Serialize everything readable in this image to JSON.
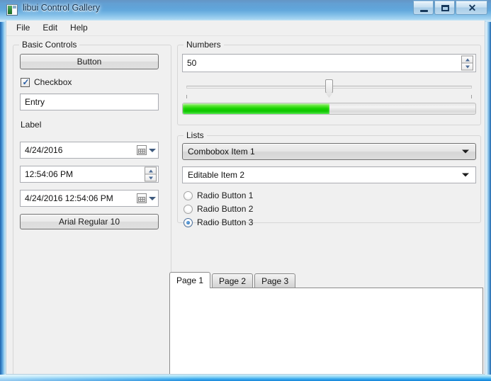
{
  "window": {
    "title": "libui Control Gallery",
    "icon": "app-icon",
    "minimize_label": "–",
    "maximize_label": "❐",
    "close_label": "✕"
  },
  "menu": {
    "items": [
      {
        "label": "File"
      },
      {
        "label": "Edit"
      },
      {
        "label": "Help"
      }
    ]
  },
  "basic_controls": {
    "title": "Basic Controls",
    "button_label": "Button",
    "checkbox_label": "Checkbox",
    "checkbox_checked": true,
    "entry_value": "Entry",
    "entry_placeholder": "",
    "label_text": "Label",
    "date_value": "4/24/2016",
    "time_value": "12:54:06 PM",
    "datetime_value": "4/24/2016 12:54:06 PM",
    "font_button_label": "Arial Regular 10"
  },
  "numbers": {
    "title": "Numbers",
    "spinbox_value": "50",
    "slider_value": 50,
    "slider_min": 0,
    "slider_max": 100,
    "progress_value": 50
  },
  "lists": {
    "title": "Lists",
    "combobox_value": "Combobox Item 1",
    "editable_combobox_value": "Editable Item 2",
    "radios": [
      {
        "label": "Radio Button 1",
        "selected": false
      },
      {
        "label": "Radio Button 2",
        "selected": false
      },
      {
        "label": "Radio Button 3",
        "selected": true
      }
    ]
  },
  "tabs": {
    "items": [
      {
        "label": "Page 1",
        "active": true
      },
      {
        "label": "Page 2",
        "active": false
      },
      {
        "label": "Page 3",
        "active": false
      }
    ],
    "page_content": ""
  },
  "colors": {
    "accent": "#2a5fa5",
    "progress_green": "#18d400",
    "window_bg": "#f0f0f0",
    "frame_blue": "#1c63ab"
  }
}
